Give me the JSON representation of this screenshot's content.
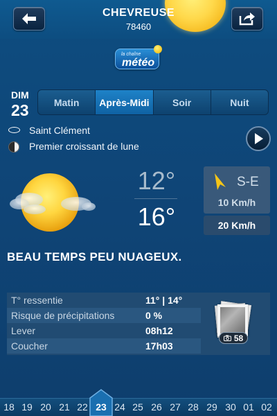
{
  "header": {
    "city": "CHEVREUSE",
    "postal_code": "78460",
    "back_icon": "back-arrow-icon",
    "share_icon": "share-icon"
  },
  "logo": {
    "small_text": "la chaîne",
    "big_text": "météo"
  },
  "day": {
    "abbr": "DIM",
    "number": "23"
  },
  "periods": [
    {
      "label": "Matin",
      "active": false
    },
    {
      "label": "Après-Midi",
      "active": true
    },
    {
      "label": "Soir",
      "active": false
    },
    {
      "label": "Nuit",
      "active": false
    }
  ],
  "saint": "Saint Clément",
  "moon_phase": "Premier croissant de lune",
  "weather": {
    "icon": "sun-cloud-icon",
    "temp_min": "12°",
    "temp_max": "16°",
    "wind_direction": "S-E",
    "wind_speed": "10 Km/h",
    "wind_gust": "20 Km/h",
    "description": "BEAU TEMPS PEU NUAGEUX."
  },
  "details": [
    {
      "label": "T° ressentie",
      "value": "11° | 14°"
    },
    {
      "label": "Risque de précipitations",
      "value": "0 %"
    },
    {
      "label": "Lever",
      "value": "08h12"
    },
    {
      "label": "Coucher",
      "value": "17h03"
    }
  ],
  "photos": {
    "count": "58"
  },
  "dates": [
    "18",
    "19",
    "20",
    "21",
    "22",
    "23",
    "24",
    "25",
    "26",
    "27",
    "28",
    "29",
    "30",
    "01",
    "02"
  ],
  "active_date": "23",
  "colors": {
    "background": "#0e4577",
    "active_tab": "#1373b8",
    "sun": "#ffd84a",
    "wind_arrow": "#f5c518"
  }
}
